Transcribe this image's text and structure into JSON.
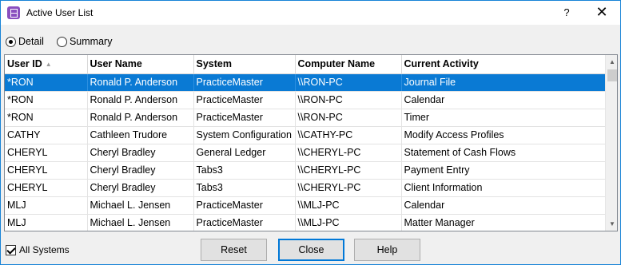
{
  "window": {
    "title": "Active User List",
    "help_label": "?",
    "close_label": "✕"
  },
  "view_options": [
    {
      "label": "Detail",
      "checked": true
    },
    {
      "label": "Summary",
      "checked": false
    }
  ],
  "table": {
    "columns": [
      "User ID",
      "User Name",
      "System",
      "Computer Name",
      "Current Activity"
    ],
    "sort_column": "User ID",
    "sort_direction": "ascending",
    "selected_row": 0,
    "rows": [
      [
        "*RON",
        "Ronald P. Anderson",
        "PracticeMaster",
        "\\\\RON-PC",
        "Journal File"
      ],
      [
        "*RON",
        "Ronald P. Anderson",
        "PracticeMaster",
        "\\\\RON-PC",
        "Calendar"
      ],
      [
        "*RON",
        "Ronald P. Anderson",
        "PracticeMaster",
        "\\\\RON-PC",
        "Timer"
      ],
      [
        "CATHY",
        "Cathleen Trudore",
        "System Configuration",
        "\\\\CATHY-PC",
        "Modify Access Profiles"
      ],
      [
        "CHERYL",
        "Cheryl Bradley",
        "General Ledger",
        "\\\\CHERYL-PC",
        "Statement of Cash Flows"
      ],
      [
        "CHERYL",
        "Cheryl Bradley",
        "Tabs3",
        "\\\\CHERYL-PC",
        "Payment Entry"
      ],
      [
        "CHERYL",
        "Cheryl Bradley",
        "Tabs3",
        "\\\\CHERYL-PC",
        "Client Information"
      ],
      [
        "MLJ",
        "Michael L. Jensen",
        "PracticeMaster",
        "\\\\MLJ-PC",
        "Calendar"
      ],
      [
        "MLJ",
        "Michael L. Jensen",
        "PracticeMaster",
        "\\\\MLJ-PC",
        "Matter Manager"
      ]
    ]
  },
  "footer": {
    "all_systems_label": "All Systems",
    "all_systems_checked": true,
    "reset_label": "Reset",
    "close_label": "Close",
    "help_label": "Help"
  },
  "colors": {
    "selection": "#0a7ad4",
    "window_border": "#1883d7",
    "app_icon": "#8a4fbf"
  }
}
